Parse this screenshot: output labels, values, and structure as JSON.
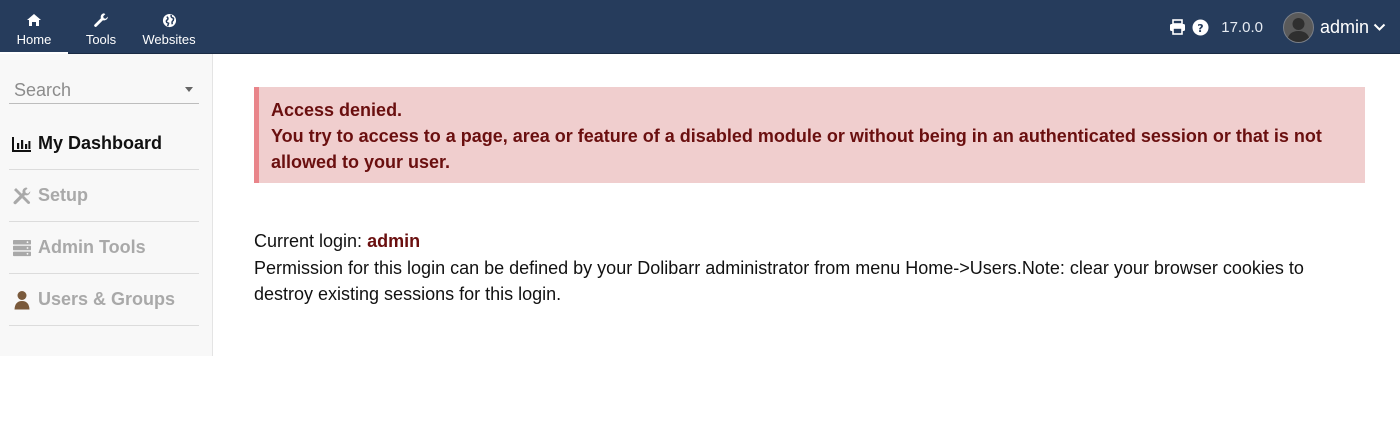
{
  "topnav": {
    "items": [
      {
        "label": "Home",
        "icon": "home-icon"
      },
      {
        "label": "Tools",
        "icon": "wrench-icon"
      },
      {
        "label": "Websites",
        "icon": "globe-icon"
      }
    ]
  },
  "topright": {
    "print_icon": "print-icon",
    "help_icon": "help-icon",
    "version": "17.0.0",
    "username": "admin"
  },
  "sidebar": {
    "search_placeholder": "Search",
    "items": [
      {
        "label": "My Dashboard",
        "icon": "chart-icon",
        "state": "active"
      },
      {
        "label": "Setup",
        "icon": "tools-icon",
        "state": "disabled"
      },
      {
        "label": "Admin Tools",
        "icon": "server-icon",
        "state": "disabled"
      },
      {
        "label": "Users & Groups",
        "icon": "user-icon",
        "state": "disabled"
      }
    ]
  },
  "alert": {
    "title": "Access denied.",
    "message": "You try to access to a page, area or feature of a disabled module or without being in an authenticated session or that is not allowed to your user."
  },
  "info": {
    "current_login_label": "Current login: ",
    "current_login_value": "admin",
    "permission_text": "Permission for this login can be defined by your Dolibarr administrator from menu Home->Users.Note: clear your browser cookies to destroy existing sessions for this login."
  },
  "colors": {
    "topbar": "#263c5c",
    "alert_bg": "#f0cece",
    "alert_border": "#e9858a",
    "alert_text": "#6a0f0f",
    "disabled_text": "#a9a9a9"
  }
}
